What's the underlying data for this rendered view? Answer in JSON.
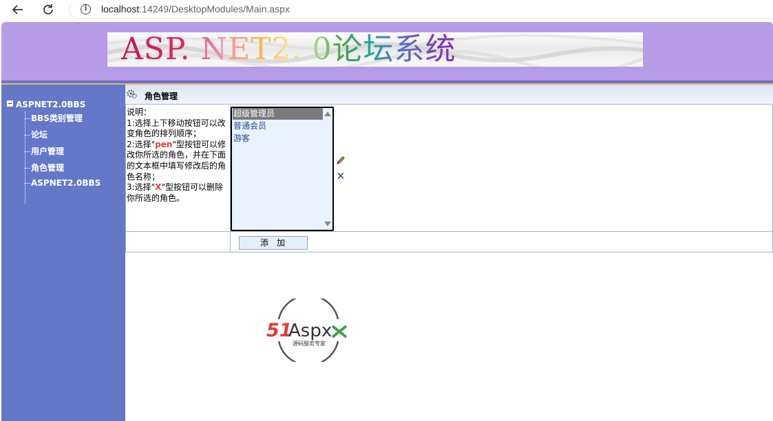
{
  "browser": {
    "url_host": "localhost",
    "url_rest": ":14249/DesktopModules/Main.aspx"
  },
  "header": {
    "banner_text": "ASP. NET2. 0论坛系统"
  },
  "sidebar": {
    "root": "ASPNET2.0BBS",
    "items": [
      {
        "label": "BBS类别管理"
      },
      {
        "label": "论坛"
      },
      {
        "label": "用户管理"
      },
      {
        "label": "角色管理"
      },
      {
        "label": "ASPNET2.0BBS"
      }
    ]
  },
  "main": {
    "title": "角色管理",
    "description": {
      "line0": "说明：",
      "line1": "1:选择上下移动按钮可以改变角色的排列顺序；",
      "line2_pre": "2:选择\"",
      "line2_hl": "pen",
      "line2_post": "\"型按钮可以修改你所选的角色，并在下面的文本框中填写修改后的角色名称；",
      "line3_pre": "3:选择\"",
      "line3_hl": "X",
      "line3_post": "\"型按钮可以删除你所选的角色。"
    },
    "roles": [
      "超级管理员",
      "普通会员",
      "游客"
    ],
    "add_label": "添加"
  },
  "logo": {
    "brand_51": "51",
    "brand_aspx": "Aspx",
    "slogan": "源码服务专家"
  }
}
